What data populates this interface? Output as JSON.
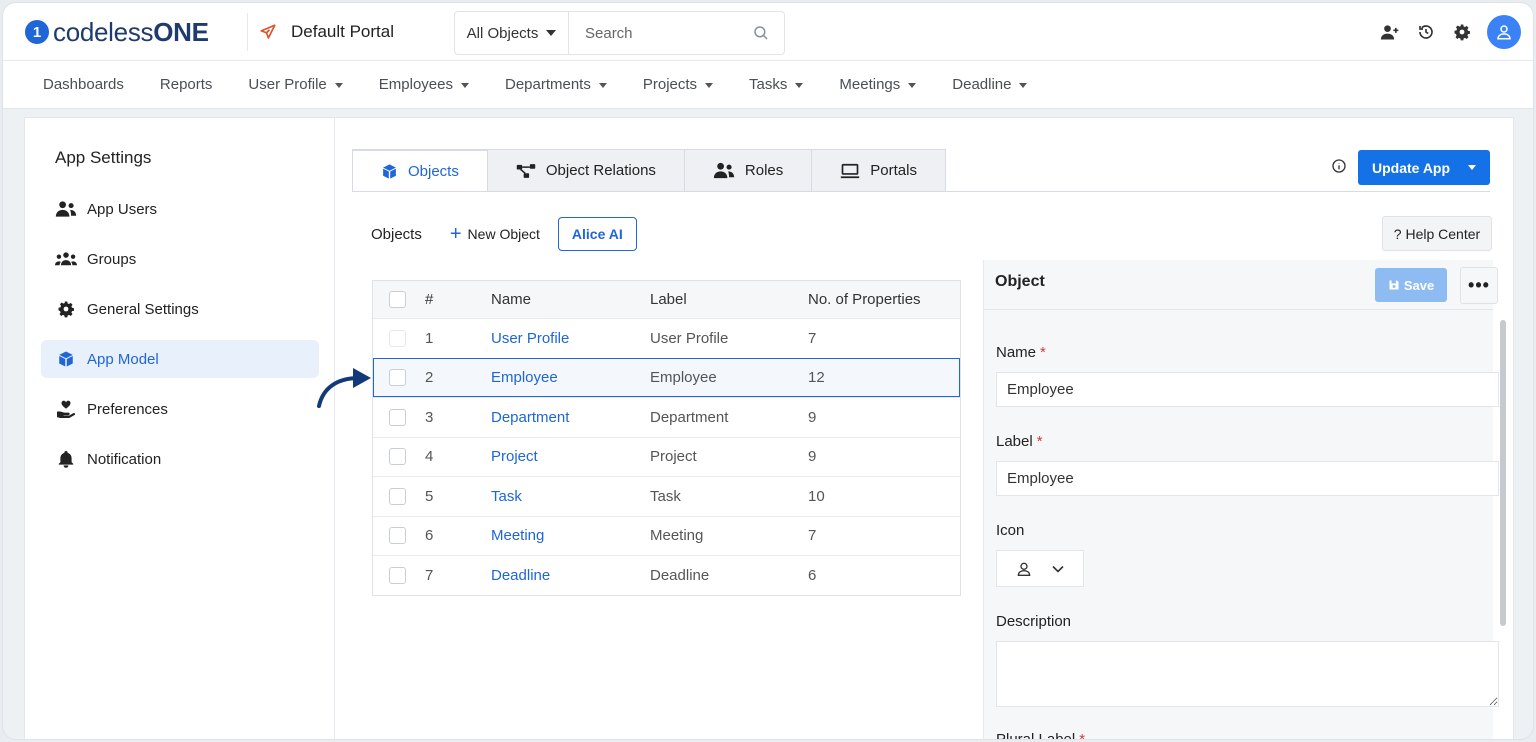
{
  "colors": {
    "accent": "#1f66d6",
    "primary_button": "#1471e6",
    "required": "#d23a3a"
  },
  "header": {
    "logo_prefix": "codeless",
    "logo_bold": "ONE",
    "portal_name": "Default Portal",
    "search": {
      "scope": "All Objects",
      "placeholder": "Search"
    },
    "icons": [
      "add-user-icon",
      "history-icon",
      "gear-icon",
      "user-avatar-icon"
    ]
  },
  "nav": {
    "items": [
      {
        "label": "Dashboards",
        "dropdown": false
      },
      {
        "label": "Reports",
        "dropdown": false
      },
      {
        "label": "User Profile",
        "dropdown": true
      },
      {
        "label": "Employees",
        "dropdown": true
      },
      {
        "label": "Departments",
        "dropdown": true
      },
      {
        "label": "Projects",
        "dropdown": true
      },
      {
        "label": "Tasks",
        "dropdown": true
      },
      {
        "label": "Meetings",
        "dropdown": true
      },
      {
        "label": "Deadline",
        "dropdown": true
      }
    ]
  },
  "sidebar": {
    "title": "App Settings",
    "items": [
      {
        "label": "App Users",
        "icon": "users-icon",
        "active": false
      },
      {
        "label": "Groups",
        "icon": "group-icon",
        "active": false
      },
      {
        "label": "General Settings",
        "icon": "gear-icon",
        "active": false
      },
      {
        "label": "App Model",
        "icon": "cube-icon",
        "active": true
      },
      {
        "label": "Preferences",
        "icon": "hand-heart-icon",
        "active": false
      },
      {
        "label": "Notification",
        "icon": "bell-icon",
        "active": false
      }
    ]
  },
  "tabs": [
    {
      "label": "Objects",
      "icon": "cube-icon",
      "active": true
    },
    {
      "label": "Object Relations",
      "icon": "relations-icon",
      "active": false
    },
    {
      "label": "Roles",
      "icon": "users-icon",
      "active": false
    },
    {
      "label": "Portals",
      "icon": "laptop-icon",
      "active": false
    }
  ],
  "toolbar": {
    "update_app": "Update App",
    "objects_label": "Objects",
    "new_object": "New Object",
    "alice_ai": "Alice AI",
    "help_center": "? Help Center"
  },
  "table": {
    "columns": [
      "#",
      "Name",
      "Label",
      "No. of Properties"
    ],
    "rows": [
      {
        "num": "1",
        "name": "User Profile",
        "label": "User Profile",
        "props": "7"
      },
      {
        "num": "2",
        "name": "Employee",
        "label": "Employee",
        "props": "12"
      },
      {
        "num": "3",
        "name": "Department",
        "label": "Department",
        "props": "9"
      },
      {
        "num": "4",
        "name": "Project",
        "label": "Project",
        "props": "9"
      },
      {
        "num": "5",
        "name": "Task",
        "label": "Task",
        "props": "10"
      },
      {
        "num": "6",
        "name": "Meeting",
        "label": "Meeting",
        "props": "7"
      },
      {
        "num": "7",
        "name": "Deadline",
        "label": "Deadline",
        "props": "6"
      }
    ],
    "selected_row": 2
  },
  "object_panel": {
    "title": "Object",
    "save": "Save",
    "more": "•••",
    "fields": {
      "name_label": "Name",
      "name_value": "Employee",
      "label_label": "Label",
      "label_value": "Employee",
      "icon_label": "Icon",
      "icon_value": "user-icon",
      "description_label": "Description",
      "description_value": "",
      "plural_label": "Plural Label",
      "required_mark": "*"
    }
  }
}
